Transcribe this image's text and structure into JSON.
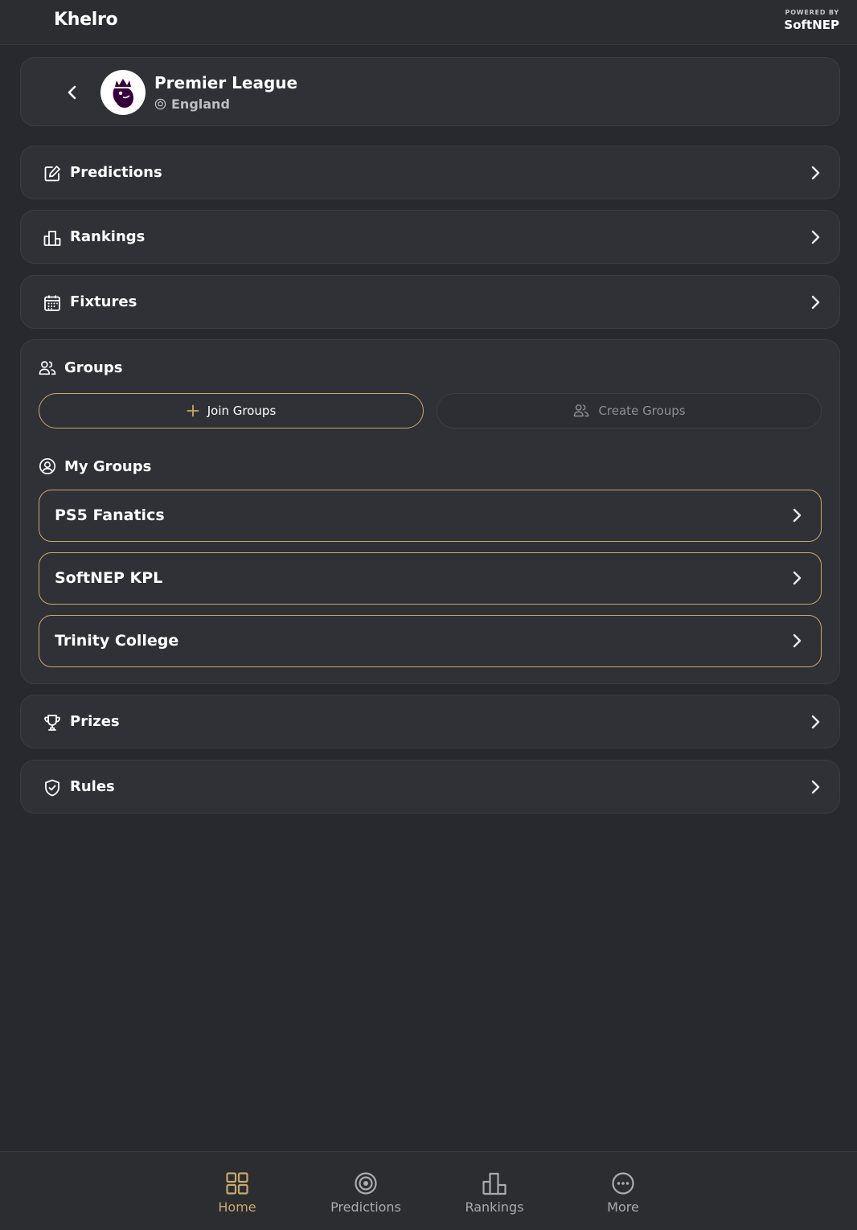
{
  "colors": {
    "accent": "#c9a86a",
    "background": "#27292e",
    "card": "#2f3136",
    "crest": "#37003c"
  },
  "header": {
    "brand": "Khelro",
    "powered_small": "POWERED BY",
    "powered_big": "SoftNEP"
  },
  "league": {
    "name": "Premier League",
    "country": "England",
    "back_icon": "chevron-left-icon",
    "crest_icon": "premier-league-lion-crest"
  },
  "menu": {
    "predictions": {
      "label": "Predictions",
      "icon": "edit-square-icon"
    },
    "rankings": {
      "label": "Rankings",
      "icon": "bar-podium-icon"
    },
    "fixtures": {
      "label": "Fixtures",
      "icon": "calendar-icon"
    },
    "prizes": {
      "label": "Prizes",
      "icon": "trophy-icon"
    },
    "rules": {
      "label": "Rules",
      "icon": "shield-check-icon"
    }
  },
  "groups": {
    "title": "Groups",
    "join_label": "Join Groups",
    "create_label": "Create Groups",
    "my_groups_title": "My Groups",
    "items": [
      {
        "name": "PS5 Fanatics"
      },
      {
        "name": "SoftNEP KPL"
      },
      {
        "name": "Trinity College"
      }
    ]
  },
  "bottom_nav": {
    "active": "Home",
    "tabs": [
      {
        "label": "Home",
        "icon": "grid-icon"
      },
      {
        "label": "Predictions",
        "icon": "target-icon"
      },
      {
        "label": "Rankings",
        "icon": "bar-podium-icon"
      },
      {
        "label": "More",
        "icon": "more-dots-icon"
      }
    ]
  }
}
